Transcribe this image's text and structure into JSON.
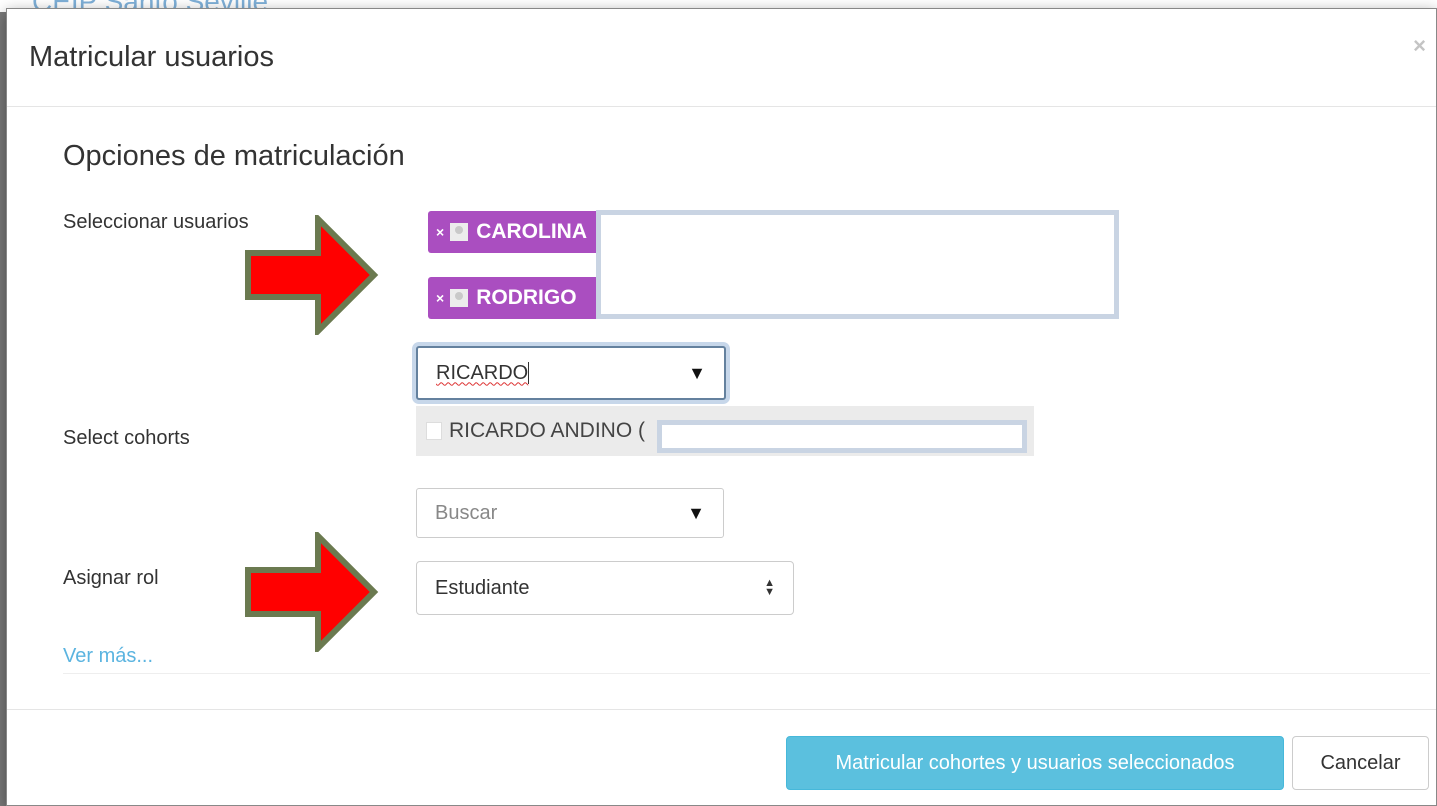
{
  "background": {
    "title": "CEIP Santo Seville"
  },
  "modal": {
    "title": "Matricular usuarios",
    "close_label": "×"
  },
  "form": {
    "section_title": "Opciones de matriculación",
    "select_users_label": "Seleccionar usuarios",
    "selected_users": [
      {
        "remove_label": "×",
        "name": "CAROLINA"
      },
      {
        "remove_label": "×",
        "name": "RODRIGO"
      }
    ],
    "user_search": {
      "value": "RICARDO",
      "toggle_icon": "▼"
    },
    "suggestion": {
      "text": "RICARDO ANDINO ("
    },
    "cohorts_label": "Select cohorts",
    "cohort_search": {
      "placeholder": "Buscar",
      "toggle_icon": "▼"
    },
    "role_label": "Asignar rol",
    "role_select": {
      "value": "Estudiante",
      "up_icon": "▲",
      "down_icon": "▼"
    },
    "show_more_link": "Ver más..."
  },
  "footer": {
    "submit_label": "Matricular cohortes y usuarios seleccionados",
    "cancel_label": "Cancelar"
  },
  "annotations": {
    "arrow_color": "#ff0000",
    "arrow_border_color": "#6b7a50"
  }
}
